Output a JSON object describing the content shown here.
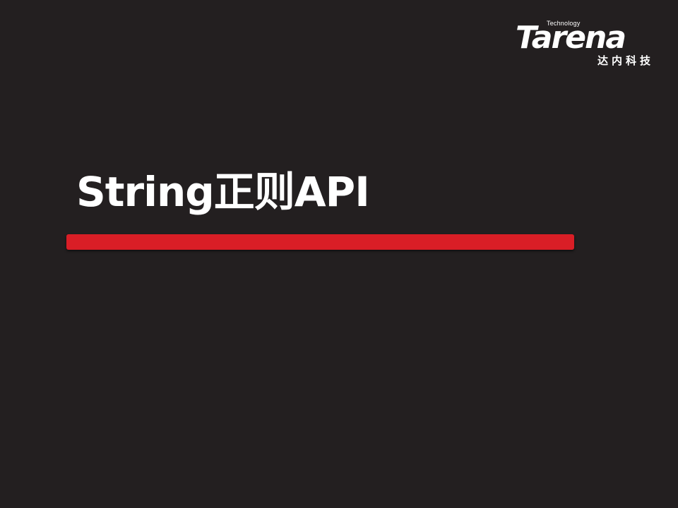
{
  "logo": {
    "technology": "Technology",
    "wordmark": "Tarena",
    "chinese": "达内科技"
  },
  "slide": {
    "title": "String正则API"
  },
  "colors": {
    "background": "#231f20",
    "accent_bar": "#d91e26",
    "text": "#ffffff"
  }
}
